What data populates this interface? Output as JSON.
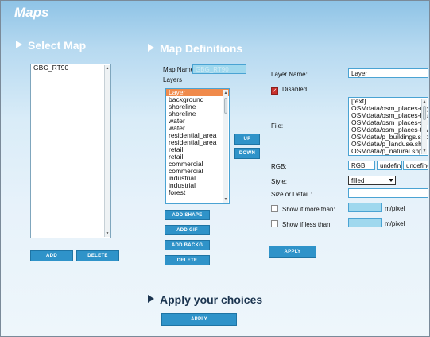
{
  "app": {
    "title": "Maps"
  },
  "select_map": {
    "heading": "Select Map",
    "maps": [
      "GBG_RT90"
    ],
    "add_label": "ADD",
    "delete_label": "DELETE"
  },
  "map_definitions": {
    "heading": "Map Definitions",
    "map_name_label": "Map Name",
    "map_name_value": "GBG_RT90",
    "layers_label": "Layers",
    "layers": [
      "Layer",
      "background",
      "shoreline",
      "shoreline",
      "water",
      "water",
      "residential_area",
      "residential_area",
      "retail",
      "retail",
      "commercial",
      "commercial",
      "industrial",
      "industrial",
      "forest"
    ],
    "selected_layer_index": 0,
    "up_label": "UP",
    "down_label": "DOWN",
    "add_shape_label": "ADD SHAPE",
    "add_gif_label": "ADD GIF",
    "add_backg_label": "ADD BACKG",
    "delete_label": "DELETE"
  },
  "layer_form": {
    "layer_name_label": "Layer Name:",
    "layer_name_value": "Layer",
    "disabled_label": "Disabled",
    "disabled_checked": true,
    "file_label": "File:",
    "files": [
      "[text]",
      "OSMdata/osm_places-city.sh",
      "OSMdata/osm_places-hamle",
      "OSMdata/osm_places-subur",
      "OSMdata/osm_places-town.",
      "OSMdata/p_buildings.shp",
      "OSMdata/p_landuse.shp",
      "OSMdata/p_natural.shp"
    ],
    "rgb_label": "RGB:",
    "rgb_values": [
      "RGB",
      "undefinec",
      "undefinec"
    ],
    "style_label": "Style:",
    "style_value": "filled",
    "size_label": "Size or Detail :",
    "size_value": "",
    "show_more_label": "Show if more than:",
    "show_less_label": "Show if less than:",
    "unit_label": "m/pixel",
    "apply_label": "APPLY"
  },
  "apply_choices": {
    "heading": "Apply your choices",
    "apply_label": "APPLY"
  },
  "colors": {
    "button": "#2f93c9",
    "selected": "#f08a4b",
    "checkbox_on": "#c9302c"
  }
}
